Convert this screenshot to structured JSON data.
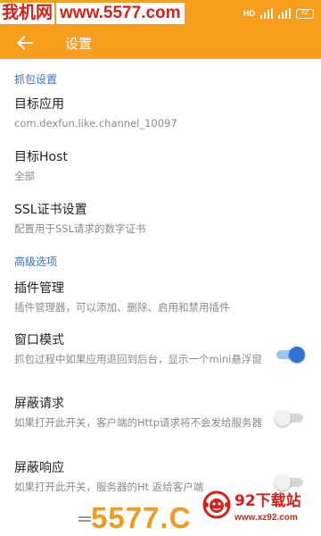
{
  "watermark_top": {
    "part1": "我机网",
    "part2": "www.5577.com"
  },
  "status_bar": {
    "network_label": "HD",
    "battery": "62"
  },
  "header": {
    "title": "设置"
  },
  "sections": [
    {
      "header": "抓包设置"
    },
    {
      "header": "高级选项"
    }
  ],
  "prefs": {
    "target_app": {
      "title": "目标应用",
      "summary": "com.dexfun.like.channel_10097"
    },
    "target_host": {
      "title": "目标Host",
      "summary": "全部"
    },
    "ssl": {
      "title": "SSL证书设置",
      "summary": "配置用于SSL请求的数字证书"
    },
    "plugins": {
      "title": "插件管理",
      "summary": "插件管理器，可以添加、删除、启用和禁用插件"
    },
    "window_mode": {
      "title": "窗口模式",
      "summary": "抓包过程中如果应用退回到后台，显示一个mini悬浮窗",
      "on": true
    },
    "block_request": {
      "title": "屏蔽请求",
      "summary": "如果打开此开关，客户端的Http请求将不会发给服务器",
      "on": false
    },
    "block_response": {
      "title": "屏蔽响应",
      "summary": "如果打开此开关，服务器的Ht 返给客户端",
      "on": false
    }
  },
  "watermark_bottom": {
    "brand": "5577.C",
    "site_name": "92下载站",
    "site_url": "www.xz92.com"
  },
  "colors": {
    "accent": "#f99d1c",
    "section_blue": "#2c74d6",
    "watermark_red": "#d8201a",
    "watermark_orange": "#f49a1e"
  }
}
